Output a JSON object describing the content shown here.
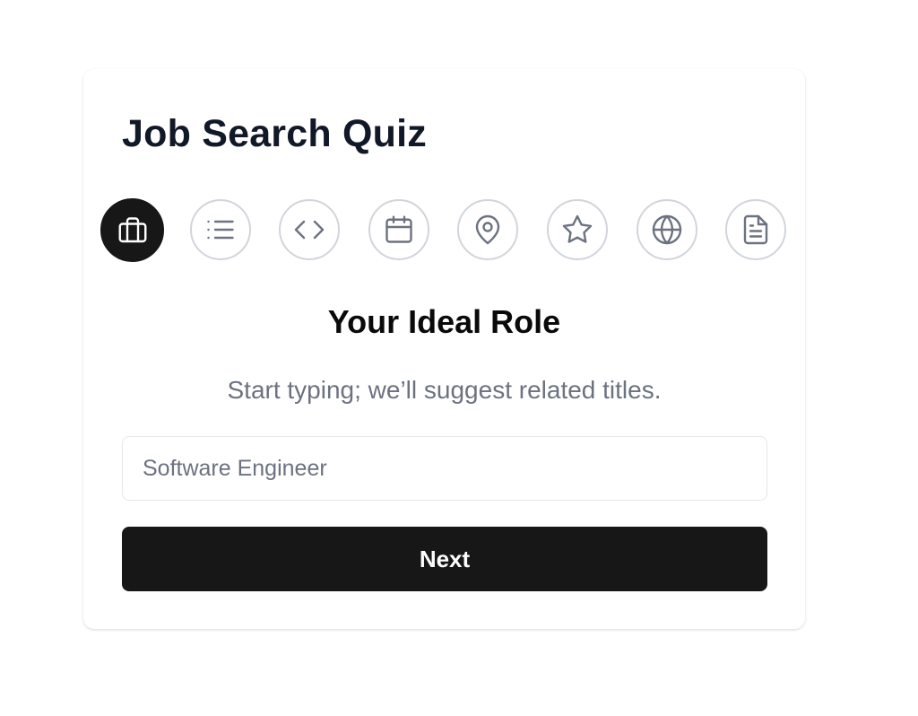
{
  "quiz": {
    "title": "Job Search Quiz"
  },
  "steps": [
    {
      "icon": "briefcase-icon",
      "active": true
    },
    {
      "icon": "list-icon",
      "active": false
    },
    {
      "icon": "code-icon",
      "active": false
    },
    {
      "icon": "calendar-icon",
      "active": false
    },
    {
      "icon": "map-pin-icon",
      "active": false
    },
    {
      "icon": "star-icon",
      "active": false
    },
    {
      "icon": "globe-icon",
      "active": false
    },
    {
      "icon": "document-icon",
      "active": false
    }
  ],
  "current_step": {
    "title": "Your Ideal Role",
    "subtitle": "Start typing; we’ll suggest related titles.",
    "input_placeholder": "Software Engineer",
    "input_value": ""
  },
  "actions": {
    "next_label": "Next"
  },
  "colors": {
    "primary": "#171717",
    "title": "#111827",
    "muted": "#6b7280",
    "border": "#d1d5db"
  }
}
